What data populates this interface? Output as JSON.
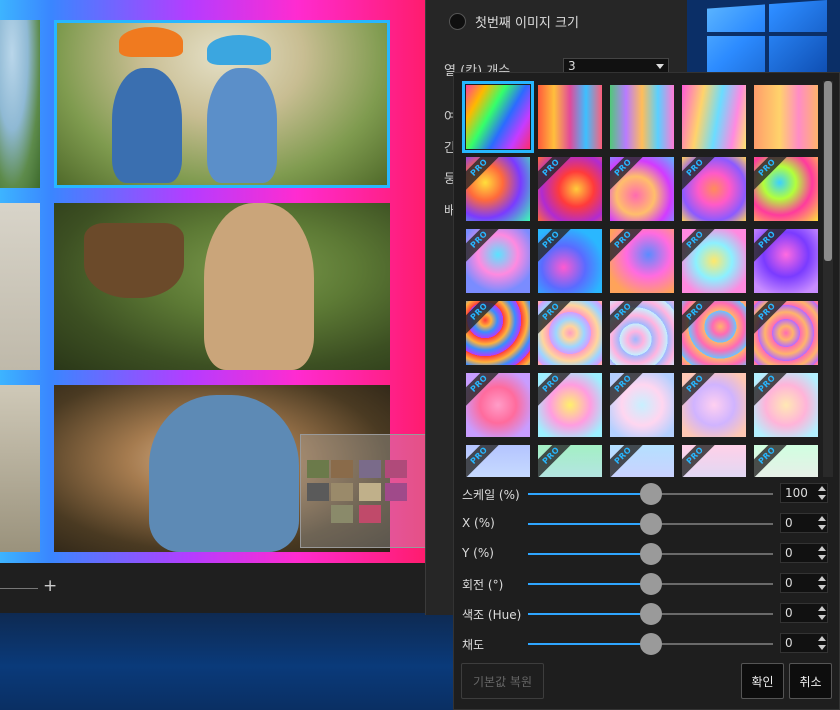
{
  "settings": {
    "first_image_size_label": "첫번째 이미지 크기",
    "columns_label": "열 (칸) 개수",
    "columns_value": "3",
    "partial_labels": [
      "여",
      "간",
      "둥",
      "배"
    ]
  },
  "canvas": {
    "zoom_plus": "+"
  },
  "swatches": [
    {
      "pro": false,
      "selected": true,
      "bg": "linear-gradient(120deg,#ff3b9b,#ffb800 20%,#35ff6a 40%,#2b6bff 60%,#c63bff 80%,#ff2d6a)"
    },
    {
      "pro": false,
      "selected": false,
      "bg": "linear-gradient(90deg,#ff5a3c,#ffbf3c 25%,#e24a9a 50%,#3cc0ff 75%,#ff5e7a)"
    },
    {
      "pro": false,
      "selected": false,
      "bg": "linear-gradient(90deg,#50c878,#b87bff 25%,#ffbd59 50%,#5ad0ff 75%,#ff7ad5)"
    },
    {
      "pro": false,
      "selected": false,
      "bg": "linear-gradient(100deg,#ff5ad9,#ffd36b 30%,#6bdcff 55%,#ff8ae0 80%,#ffe76b)"
    },
    {
      "pro": false,
      "selected": false,
      "bg": "linear-gradient(90deg,#ff9d6b,#ffd26b 40%,#ff8cc6 70%,#ffb36b)"
    },
    {
      "pro": true,
      "selected": false,
      "bg": "radial-gradient(circle at 30% 40%,#ffdf3b,#ff6a3b 30%,#7a3bff 60%,#3bffb3)"
    },
    {
      "pro": true,
      "selected": false,
      "bg": "radial-gradient(circle at 60% 50%,#ffcc3b,#ff3b3b 35%,#b02bd1 70%,#ff6b3b)"
    },
    {
      "pro": true,
      "selected": false,
      "bg": "radial-gradient(circle at 40% 60%,#ff6bb0,#ffbe6b 35%,#d23bff 65%,#5bb8ff)"
    },
    {
      "pro": true,
      "selected": false,
      "bg": "radial-gradient(circle at 50% 50%,#ff8c5a,#ff5ac8 35%,#8c5aff 70%,#ffd15a)"
    },
    {
      "pro": true,
      "selected": false,
      "bg": "radial-gradient(circle at 40% 40%,#3bd1ff,#b3ff3b 30%,#ff3b9d 60%,#ffe03b)"
    },
    {
      "pro": true,
      "selected": false,
      "bg": "radial-gradient(circle at 50% 40%,#5ae3ff,#ff8ae0 40%,#7a8cff 75%)"
    },
    {
      "pro": true,
      "selected": false,
      "bg": "radial-gradient(circle at 40% 60%,#ff5ad0,#5a6bff 40%,#2ab7ff 75%)"
    },
    {
      "pro": true,
      "selected": false,
      "bg": "radial-gradient(circle at 60% 40%,#5a8cff,#ff6be0 40%,#ffa35a 80%)"
    },
    {
      "pro": true,
      "selected": false,
      "bg": "radial-gradient(circle at 50% 50%,#ffe86b,#8cf0ff 40%,#ff8ae0 80%)"
    },
    {
      "pro": true,
      "selected": false,
      "bg": "radial-gradient(circle at 50% 40%,#ff6be0,#7a3bff 45%,#c88cff 85%)"
    },
    {
      "pro": true,
      "selected": false,
      "bg": "repeating-radial-gradient(circle at 30% 30%,#ff3b3b 0,#ffb13b 6px,#3b8cff 12px,#b33bff 18px)"
    },
    {
      "pro": true,
      "selected": false,
      "bg": "repeating-radial-gradient(circle at 50% 50%,#ff9dc1 0,#ffd59d 7px,#9dd6ff 14px,#d39dff 21px)"
    },
    {
      "pro": true,
      "selected": false,
      "bg": "repeating-radial-gradient(circle at 40% 60%,#9db8ff 0,#ffb4e0 8px,#c4f0ff 16px)"
    },
    {
      "pro": true,
      "selected": false,
      "bg": "repeating-radial-gradient(circle at 60% 40%,#ffb46b 0,#ff6bb4 8px,#6bc4ff 16px)"
    },
    {
      "pro": true,
      "selected": false,
      "bg": "repeating-radial-gradient(circle at 50% 50%,#ff6bb4 0,#ffb46b 7px,#b46bff 14px)"
    },
    {
      "pro": true,
      "selected": false,
      "bg": "radial-gradient(circle at 50% 50%,#ff9dc8,#ff6b9d 40%,#c89dff 80%)"
    },
    {
      "pro": true,
      "selected": false,
      "bg": "radial-gradient(circle at 50% 50%,#fff06b,#ff9de0 45%,#9df0ff 85%)"
    },
    {
      "pro": true,
      "selected": false,
      "bg": "radial-gradient(circle at 50% 50%,#c8f0ff,#ffd6f0 45%,#b4d0ff 85%)"
    },
    {
      "pro": true,
      "selected": false,
      "bg": "radial-gradient(circle at 50% 50%,#ffd0f0,#d0b4ff 45%,#ffc8b4 85%)"
    },
    {
      "pro": true,
      "selected": false,
      "bg": "radial-gradient(circle at 50% 50%,#ffe8b4,#ffb4d9 45%,#b4f0ff 85%)"
    },
    {
      "pro": true,
      "selected": false,
      "bg": "linear-gradient(180deg,#b4c4ff,#d9f0ff)"
    },
    {
      "pro": true,
      "selected": false,
      "bg": "linear-gradient(180deg,#a3f0c4,#c4d9ff)"
    },
    {
      "pro": true,
      "selected": false,
      "bg": "linear-gradient(180deg,#b4e0ff,#e0c4ff)"
    },
    {
      "pro": true,
      "selected": false,
      "bg": "linear-gradient(180deg,#ffd0e8,#c4e0ff)"
    },
    {
      "pro": true,
      "selected": false,
      "bg": "linear-gradient(180deg,#d0ffe0,#ffe0f0)"
    }
  ],
  "sliders": [
    {
      "label": "스케일 (%)",
      "value": "100",
      "level": 0.5
    },
    {
      "label": "X (%)",
      "value": "0",
      "level": 0.5
    },
    {
      "label": "Y (%)",
      "value": "0",
      "level": 0.5
    },
    {
      "label": "회전 (°)",
      "value": "0",
      "level": 0.5
    },
    {
      "label": "색조 (Hue)",
      "value": "0",
      "level": 0.5
    },
    {
      "label": "채도",
      "value": "0",
      "level": 0.5
    }
  ],
  "buttons": {
    "reset": "기본값 복원",
    "ok": "확인",
    "cancel": "취소"
  },
  "colors": {
    "accent": "#27b7ff",
    "slider_fill": "#2fa6ff"
  }
}
